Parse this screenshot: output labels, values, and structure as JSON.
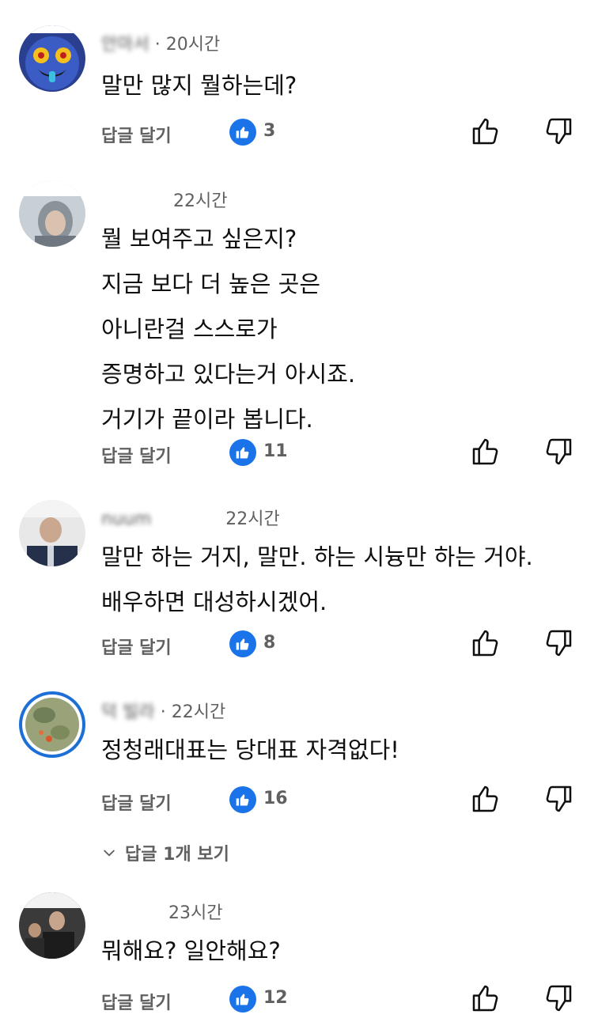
{
  "comments": [
    {
      "author": "안마서",
      "time": "20시간",
      "lines": [
        "말만 많지 뭘하는데?"
      ],
      "reply_label": "답글 달기",
      "likes": "3"
    },
    {
      "author": "",
      "time": "22시간",
      "lines": [
        "뭘 보여주고 싶은지?",
        "지금 보다 더 높은 곳은",
        "아니란걸 스스로가",
        "증명하고 있다는거 아시죠.",
        "거기가 끝이라 봅니다."
      ],
      "reply_label": "답글 달기",
      "likes": "11"
    },
    {
      "author": "nuum",
      "time": "22시간",
      "lines": [
        "말만 하는 거지, 말만. 하는 시늉만 하는 거야.",
        "배우하면 대성하시겠어."
      ],
      "reply_label": "답글 달기",
      "likes": "8"
    },
    {
      "author": "덕 빌라",
      "time": "22시간",
      "lines": [
        "정청래대표는 당대표 자격없다!"
      ],
      "reply_label": "답글 달기",
      "likes": "16",
      "view_replies": "답글 1개 보기"
    },
    {
      "author": "",
      "time": "23시간",
      "lines": [
        "뭐해요? 일안해요?"
      ],
      "reply_label": "답글 달기",
      "likes": "12"
    }
  ],
  "colors": {
    "like_badge": "#1a73e8",
    "secondary_text": "#606060",
    "primary_text": "#0f0f0f"
  },
  "icons": [
    "thumbs-up-icon",
    "thumbs-down-icon",
    "like-badge-icon",
    "chevron-down-icon"
  ]
}
